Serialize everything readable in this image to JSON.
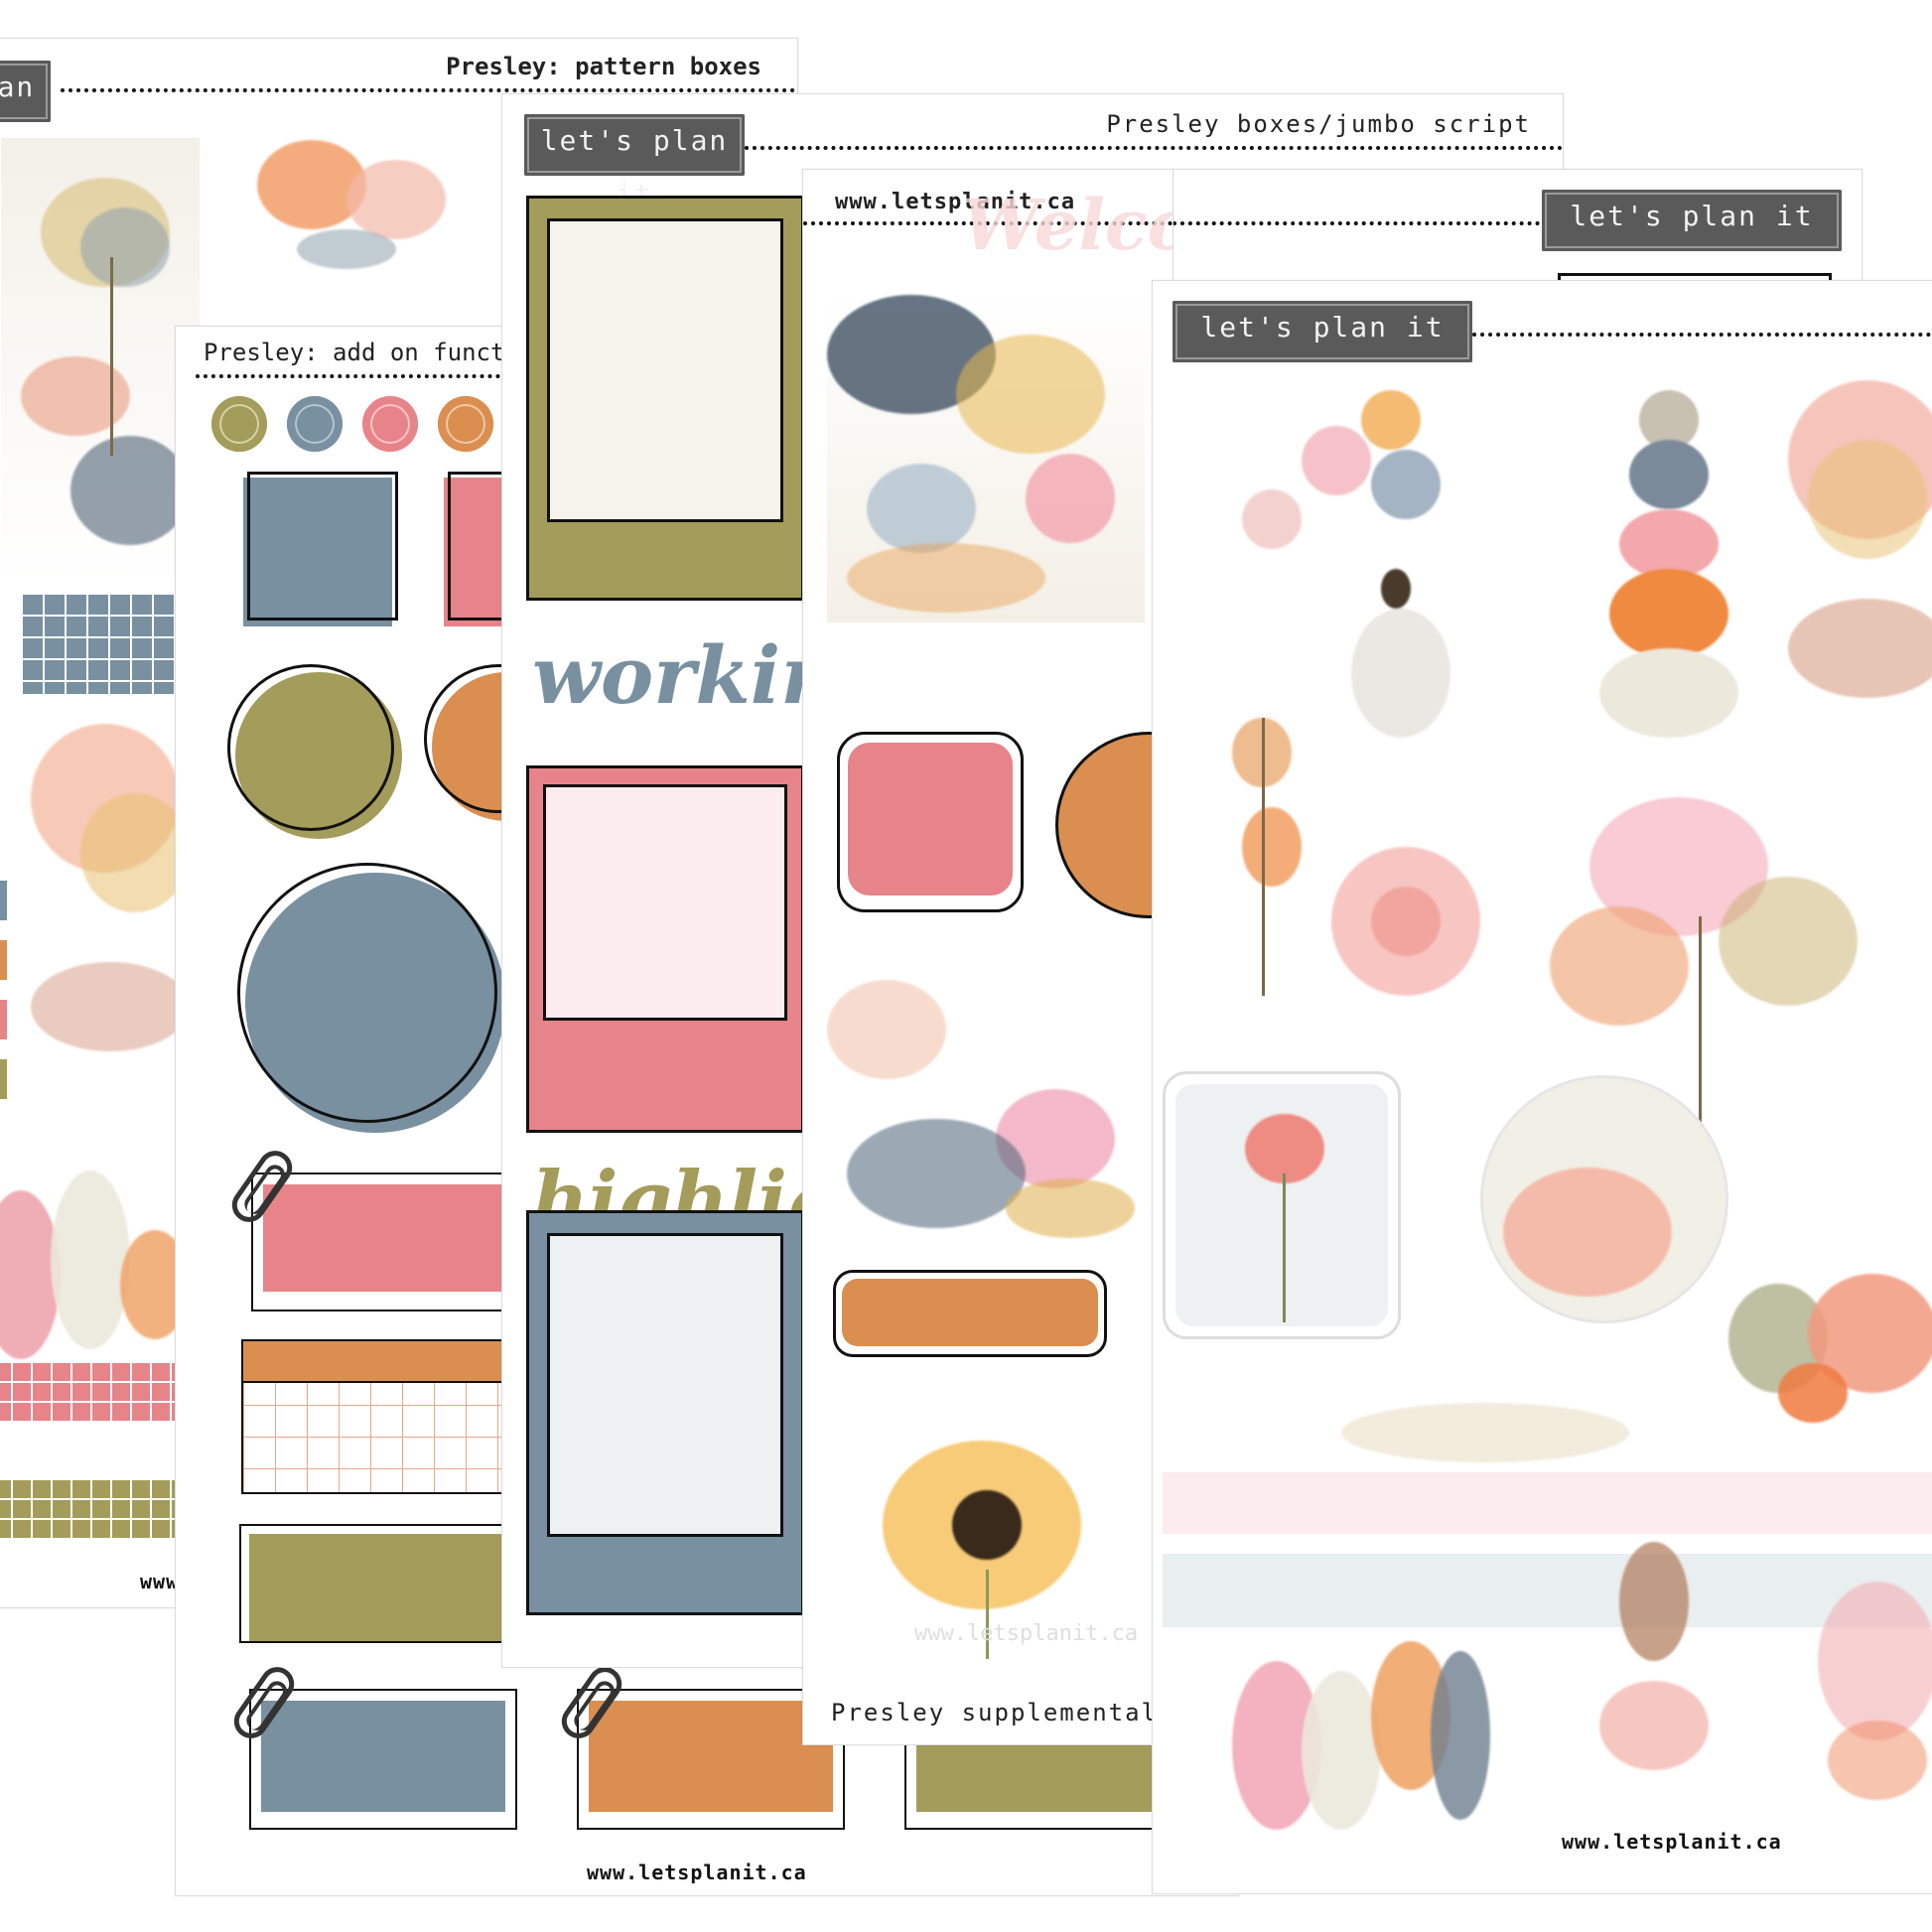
{
  "sheets": {
    "pattern_boxes": {
      "title": "Presley: pattern boxes",
      "tag": "let's plan it",
      "url": "www.letsplanit.ca"
    },
    "add_on_functional": {
      "title": "Presley: add on functional",
      "url": "www.letsplanit.ca"
    },
    "boxes_jumbo": {
      "title": "Presley boxes/jumbo script",
      "tag": "let's plan it",
      "script1": "working on",
      "script2": "highlights"
    },
    "supplemental": {
      "url": "www.letsplanit.ca",
      "title": "Presley supplemental",
      "faded_script": "Welcome monday",
      "watermark_url": "www.letsplanit.ca"
    },
    "back_right": {
      "tag": "let's plan it"
    },
    "front": {
      "tag": "let's plan it",
      "url": "www.letsplanit.ca"
    }
  },
  "colors": {
    "olive": "#a39c5a",
    "slate": "#7890a0",
    "coral": "#e6848a",
    "orange": "#da8e50",
    "cream": "#f6f3ea",
    "pink_light": "#fcecee",
    "tag_gray": "#5a5a5a"
  },
  "icons": [
    "paperclip-icon",
    "checkbox-icon",
    "sunflower-icon",
    "pumpkin-icon",
    "pear-icon",
    "tree-icon",
    "flower-icon",
    "girl-balloons-icon",
    "pinecone-icon"
  ]
}
